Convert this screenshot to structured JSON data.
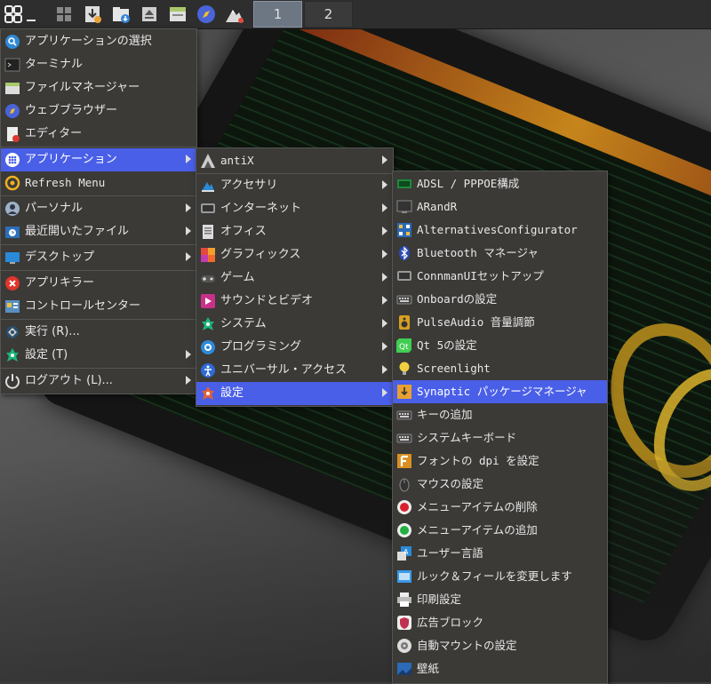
{
  "taskbar": {
    "desktops": [
      "1",
      "2"
    ]
  },
  "main_menu": {
    "items": [
      {
        "label": "アプリケーションの選択",
        "icon": "search-icon"
      },
      {
        "label": "ターミナル",
        "icon": "terminal-icon"
      },
      {
        "label": "ファイルマネージャー",
        "icon": "file-manager-icon"
      },
      {
        "label": "ウェブブラウザー",
        "icon": "web-browser-icon"
      },
      {
        "label": "エディター",
        "icon": "editor-icon"
      },
      {
        "label": "アプリケーション",
        "icon": "applications-icon"
      },
      {
        "label": "Refresh Menu",
        "icon": "refresh-icon"
      },
      {
        "label": "パーソナル",
        "icon": "personal-icon"
      },
      {
        "label": "最近開いたファイル",
        "icon": "recent-files-icon"
      },
      {
        "label": "デスクトップ",
        "icon": "desktop-icon"
      },
      {
        "label": "アプリキラー",
        "icon": "app-killer-icon"
      },
      {
        "label": "コントロールセンター",
        "icon": "control-center-icon"
      },
      {
        "label": "実行 (R)...",
        "icon": "run-icon"
      },
      {
        "label": "設定 (T)",
        "icon": "settings-icon"
      },
      {
        "label": "ログアウト (L)...",
        "icon": "logout-icon"
      }
    ]
  },
  "apps_menu": {
    "items": [
      {
        "label": "antiX",
        "icon": "antix-icon"
      },
      {
        "label": "アクセサリ",
        "icon": "accessories-icon"
      },
      {
        "label": "インターネット",
        "icon": "internet-icon"
      },
      {
        "label": "オフィス",
        "icon": "office-icon"
      },
      {
        "label": "グラフィックス",
        "icon": "graphics-icon"
      },
      {
        "label": "ゲーム",
        "icon": "games-icon"
      },
      {
        "label": "サウンドとビデオ",
        "icon": "sound-video-icon"
      },
      {
        "label": "システム",
        "icon": "system-icon"
      },
      {
        "label": "プログラミング",
        "icon": "programming-icon"
      },
      {
        "label": "ユニバーサル・アクセス",
        "icon": "accessibility-icon"
      },
      {
        "label": "設定",
        "icon": "settings-icon"
      }
    ]
  },
  "settings_menu": {
    "items": [
      {
        "label": "ADSL / PPPOE構成",
        "icon": "adsl-icon"
      },
      {
        "label": "ARandR",
        "icon": "arandr-icon"
      },
      {
        "label": "AlternativesConfigurator",
        "icon": "alternatives-icon"
      },
      {
        "label": "Bluetooth マネージャ",
        "icon": "bluetooth-icon"
      },
      {
        "label": "ConnmanUIセットアップ",
        "icon": "connman-icon"
      },
      {
        "label": "Onboardの設定",
        "icon": "keyboard-icon"
      },
      {
        "label": "PulseAudio 音量調節",
        "icon": "speaker-icon"
      },
      {
        "label": "Qt 5の設定",
        "icon": "qt-icon"
      },
      {
        "label": "Screenlight",
        "icon": "lightbulb-icon"
      },
      {
        "label": "Synaptic パッケージマネージャ",
        "icon": "synaptic-icon"
      },
      {
        "label": "キーの追加",
        "icon": "key-icon"
      },
      {
        "label": "システムキーボード",
        "icon": "keyboard-icon"
      },
      {
        "label": "フォントの dpi を設定",
        "icon": "font-icon"
      },
      {
        "label": "マウスの設定",
        "icon": "mouse-icon"
      },
      {
        "label": "メニューアイテムの削除",
        "icon": "menu-remove-icon"
      },
      {
        "label": "メニューアイテムの追加",
        "icon": "menu-add-icon"
      },
      {
        "label": "ユーザー言語",
        "icon": "language-icon"
      },
      {
        "label": "ルック＆フィールを変更します",
        "icon": "look-feel-icon"
      },
      {
        "label": "印刷設定",
        "icon": "printer-icon"
      },
      {
        "label": "広告ブロック",
        "icon": "adblock-icon"
      },
      {
        "label": "自動マウントの設定",
        "icon": "automount-icon"
      },
      {
        "label": "壁紙",
        "icon": "wallpaper-icon"
      }
    ]
  }
}
